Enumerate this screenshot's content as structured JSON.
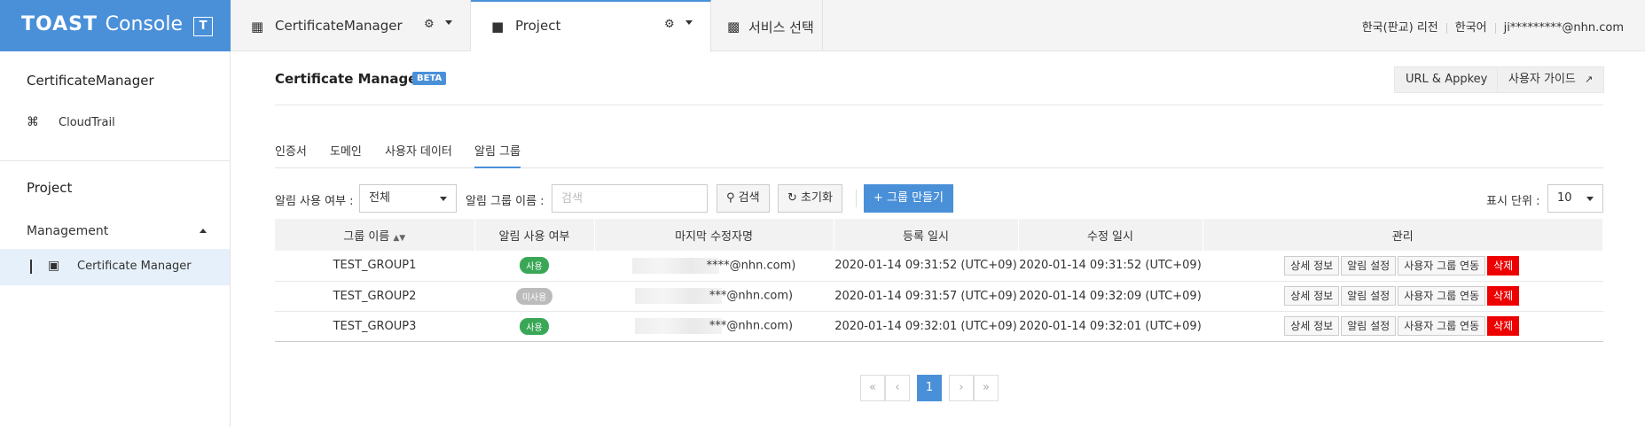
{
  "topbar": {
    "brand": "TOAST",
    "brand_suffix": "Console",
    "brand_box": "T",
    "tabs": [
      {
        "label": "CertificateManager",
        "icon": "building-icon"
      },
      {
        "label": "Project",
        "icon": "folder-icon"
      },
      {
        "label": "서비스 선택",
        "icon": "grid-icon"
      }
    ],
    "region": "한국(판교) 리전",
    "language": "한국어",
    "user": "ji*********@nhn.com"
  },
  "sidebar": {
    "org_title": "CertificateManager",
    "org_items": [
      {
        "label": "CloudTrail",
        "icon": "cloudtrail-icon"
      }
    ],
    "project_title": "Project",
    "group_title": "Management",
    "project_items": [
      {
        "label": "Certificate Manager",
        "icon": "certificate-icon"
      }
    ]
  },
  "header": {
    "title": "Certificate Manager",
    "badge": "BETA",
    "url_appkey": "URL & Appkey",
    "user_guide": "사용자 가이드"
  },
  "tabs": [
    "인증서",
    "도메인",
    "사용자 데이터",
    "알림 그룹"
  ],
  "filters": {
    "use_label": "알림 사용 여부 :",
    "use_value": "전체",
    "name_label": "알림 그룹 이름 :",
    "name_placeholder": "검색",
    "search_btn": "검색",
    "reset_btn": "초기화",
    "create_btn": "그룹 만들기",
    "unit_label": "표시 단위 :",
    "unit_value": "10"
  },
  "table": {
    "headers": [
      "그룹 이름",
      "알림 사용 여부",
      "마지막 수정자명",
      "등록 일시",
      "수정 일시",
      "관리"
    ],
    "rows": [
      {
        "name": "TEST_GROUP1",
        "status": "사용",
        "on": true,
        "modifier": "****@nhn.com)",
        "created": "2020-01-14 09:31:52 (UTC+09)",
        "updated": "2020-01-14 09:31:52 (UTC+09)"
      },
      {
        "name": "TEST_GROUP2",
        "status": "미사용",
        "on": false,
        "modifier": "***@nhn.com)",
        "created": "2020-01-14 09:31:57 (UTC+09)",
        "updated": "2020-01-14 09:32:09 (UTC+09)"
      },
      {
        "name": "TEST_GROUP3",
        "status": "사용",
        "on": true,
        "modifier": "***@nhn.com)",
        "created": "2020-01-14 09:32:01 (UTC+09)",
        "updated": "2020-01-14 09:32:01 (UTC+09)"
      }
    ],
    "actions": [
      "상세 정보",
      "알림 설정",
      "사용자 그룹 연동",
      "삭제"
    ]
  },
  "pagination": {
    "first": "«",
    "prev": "‹",
    "current": "1",
    "next": "›",
    "last": "»"
  },
  "colors": {
    "accent": "#4a90d9",
    "on": "#3aa757",
    "off": "#bbbbbb",
    "danger": "#ee0000"
  }
}
